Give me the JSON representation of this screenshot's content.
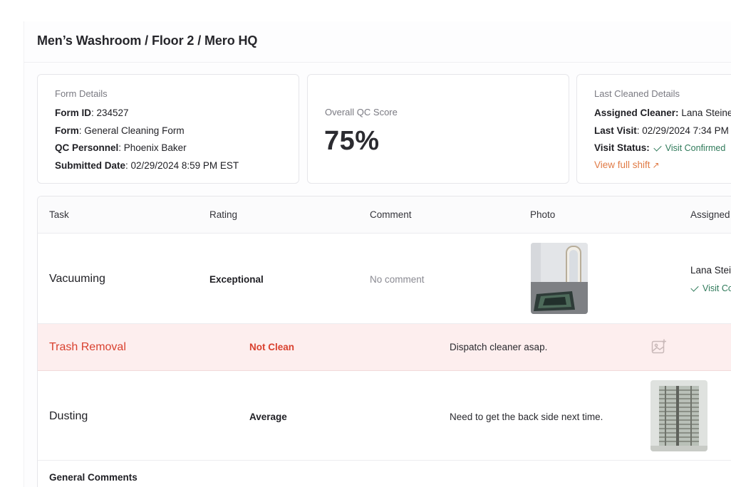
{
  "breadcrumb_title": "Men’s Washroom / Floor 2 / Mero HQ",
  "form_details": {
    "heading": "Form Details",
    "form_id_label": "Form ID",
    "form_id": ": 234527",
    "form_label": "Form",
    "form": ": General Cleaning Form",
    "qc_label": "QC Personnel",
    "qc": ": Phoenix Baker",
    "submitted_label": "Submitted Date",
    "submitted": ": 02/29/2024 8:59 PM EST"
  },
  "qc_score": {
    "heading": "Overall QC Score",
    "value": "75%"
  },
  "last_cleaned": {
    "heading": "Last Cleaned Details",
    "cleaner_label": "Assigned Cleaner:",
    "cleaner": "Lana Steiner",
    "visit_label": "Last Visit",
    "visit": ": 02/29/2024 7:34 PM",
    "status_label": "Visit Status:",
    "status": "Visit Confirmed",
    "link": "View full shift",
    "link_arrow": "↗"
  },
  "table": {
    "headers": [
      "Task",
      "Rating",
      "Comment",
      "Photo",
      "Assigned Cleaner"
    ],
    "rows": [
      {
        "task": "Vacuuming",
        "rating": "Exceptional",
        "comment": "No comment",
        "cleaner": "Lana Steiner",
        "status": "Visit Confirmed",
        "photo_icon": "photo-vacuum-room"
      },
      {
        "task": "Trash Removal",
        "rating": "Not Clean",
        "comment": "Dispatch cleaner asap.",
        "photo_icon": "image-placeholder-icon"
      },
      {
        "task": "Dusting",
        "rating": "Average",
        "comment": "Need to get the back side next time.",
        "photo_icon": "photo-window-blinds"
      }
    ],
    "general_comments": "General Comments"
  },
  "colors": {
    "accent_orange": "#e07a45",
    "success_green": "#2f7a5a",
    "danger_red": "#d9412f",
    "danger_bg": "#fdeeee"
  }
}
